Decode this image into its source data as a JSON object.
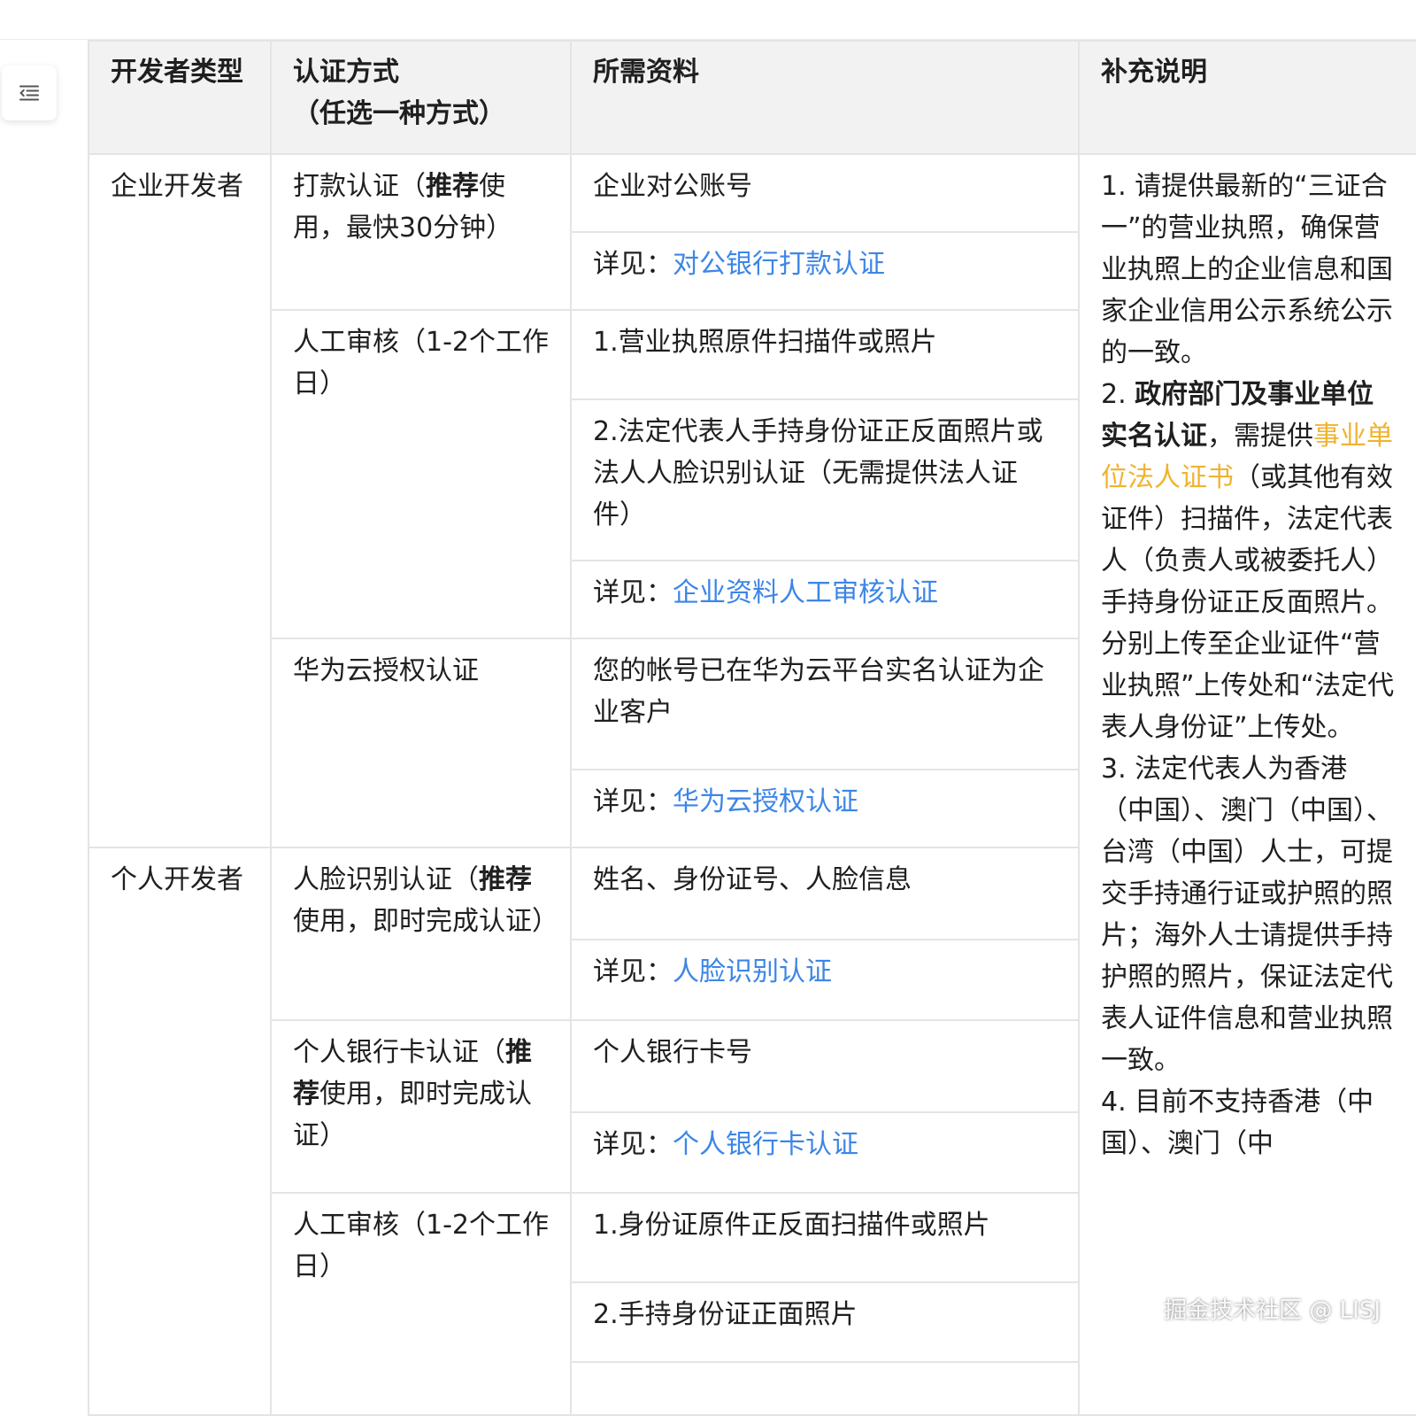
{
  "table": {
    "headers": {
      "type": "开发者类型",
      "method_line1": "认证方式",
      "method_line2": "（任选一种方式）",
      "materials": "所需资料",
      "notes": "补充说明"
    },
    "enterprise": {
      "type": "企业开发者",
      "transfer": {
        "pre": "打款认证（",
        "bold": "推荐",
        "post": "使用，最快30分钟）",
        "account": "企业对公账号",
        "detail_prefix": "详见：",
        "detail_link": "对公银行打款认证"
      },
      "manual": {
        "label": "人工审核（1-2个工作日）",
        "item1": "1.营业执照原件扫描件或照片",
        "item2": "2.法定代表人手持身份证正反面照片或法人人脸识别认证（无需提供法人证件）",
        "detail_prefix": "详见：",
        "detail_link": "企业资料人工审核认证"
      },
      "huawei": {
        "label": "华为云授权认证",
        "item": "您的帐号已在华为云平台实名认证为企业客户",
        "detail_prefix": "详见：",
        "detail_link": "华为云授权认证"
      }
    },
    "personal": {
      "type": "个人开发者",
      "face": {
        "pre": "人脸识别认证（",
        "bold": "推荐",
        "post": "使用，即时完成认证）",
        "item": "姓名、身份证号、人脸信息",
        "detail_prefix": "详见：",
        "detail_link": "人脸识别认证"
      },
      "bank": {
        "pre": "个人银行卡认证（",
        "bold": "推荐",
        "post": "使用，即时完成认证）",
        "item": "个人银行卡号",
        "detail_prefix": "详见：",
        "detail_link": "个人银行卡认证"
      },
      "manual": {
        "label": "人工审核（1-2个工作日）",
        "item1": "1.身份证原件正反面扫描件或照片",
        "item2": "2.手持身份证正面照片"
      }
    },
    "notes": {
      "n1": "1. 请提供最新的“三证合一”的营业执照，确保营业执照上的企业信息和国家企业信用公示系统公示的一致。",
      "n2_prefix": "2. ",
      "n2_bold": "政府部门及事业单位实名认证",
      "n2_mid": "，需提供",
      "n2_highlight": "事业单位法人证书",
      "n2_rest": "（或其他有效证件）扫描件，法定代表人（负责人或被委托人）手持身份证正反面照片。分别上传至企业证件“营业执照”上传处和“法定代表人身份证”上传处。",
      "n3": "3. 法定代表人为香港（中国）、澳门（中国）、台湾（中国）人士，可提交手持通行证或护照的照片；海外人士请提供手持护照的照片，保证法定代表人证件信息和营业执照一致。",
      "n4": "4. 目前不支持香港（中国）、澳门（中"
    }
  },
  "watermark": "掘金技术社区 @ LISJ",
  "icons": {
    "toc": "toc-indent-icon"
  },
  "colors": {
    "link": "#3d86e6",
    "highlight": "#f0b330",
    "header_bg": "#f2f2f2"
  }
}
